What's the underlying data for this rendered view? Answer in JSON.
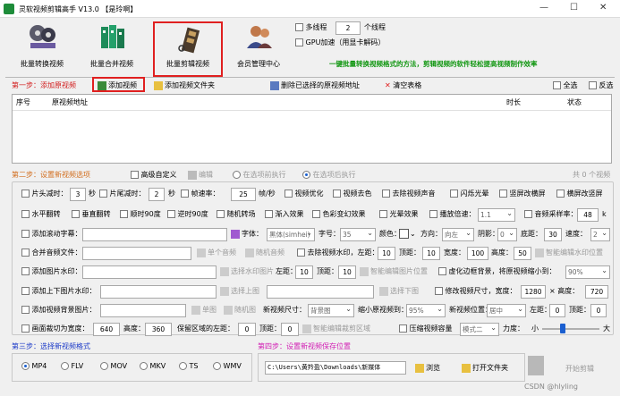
{
  "window": {
    "title": "灵软视频剪辑高手 V13.0   【是玲啊】",
    "min": "—",
    "max": "☐",
    "close": "✕"
  },
  "toolbar": {
    "items": [
      {
        "label": "批量转换视频"
      },
      {
        "label": "批量合并视频"
      },
      {
        "label": "批量剪辑视频"
      },
      {
        "label": "会员管理中心"
      }
    ],
    "multithread_label": "多线程",
    "thread_count": "2",
    "thread_unit": "个线程",
    "gpu_label": "GPU加速（用显卡解码）",
    "slogan": "一键批量转换视频格式的方法，剪辑视频的软件轻松提高视频制作效率"
  },
  "step1": {
    "title": "第一步：添加原视频",
    "add_video": "添加视频",
    "add_folder": "添加视频文件夹",
    "delete_selected": "删除已选择的原视频地址",
    "clear_table": "清空表格",
    "select_all": "全选",
    "invert": "反选"
  },
  "table": {
    "headers": [
      "序号",
      "原视频地址",
      "时长",
      "状态"
    ]
  },
  "step2": {
    "title": "第二步：设置新视频选项",
    "advanced": "高级自定义",
    "edit": "编辑",
    "exec_before": "在选项前执行",
    "exec_after": "在选项后执行",
    "count": "共 0 个视频",
    "r1": {
      "head_cut": "片头减时：",
      "head_val": "3",
      "sec1": "秒",
      "tail_cut": "片尾减时：",
      "tail_val": "2",
      "sec2": "秒",
      "framerate": "帧速率：",
      "fr_val": "25",
      "fr_unit": "帧/秒",
      "optimize": "视频优化",
      "decolor": "视频去色",
      "remove_audio": "去除视频声音",
      "flash": "闪烁光晕",
      "landscape": "竖屏改横屏",
      "portrait": "横屏改竖屏"
    },
    "r2": {
      "hflip": "水平翻转",
      "vflip": "垂直翻转",
      "cw90": "顺时90度",
      "ccw90": "逆时90度",
      "random": "随机转场",
      "fadein": "渐入效果",
      "color_change": "色彩变幻效果",
      "light": "光晕效果",
      "speed": "播放倍速：",
      "speed_val": "1.1",
      "samplerate": "音频采样率：",
      "sr_val": "48",
      "sr_unit": "k"
    },
    "r3": {
      "subtitle": "添加滚动字幕：",
      "font": "字体：",
      "font_val": "黑体(simhei)",
      "size": "字号：",
      "size_val": "35",
      "color": "颜色：",
      "dir": "方向：",
      "dir_val": "向左",
      "shadow": "阴影：",
      "shadow_val": "0",
      "bottom": "底距：",
      "bottom_val": "30",
      "speed": "速度：",
      "speed_val": "2"
    },
    "r4": {
      "merge_audio": "合并音频文件：",
      "single_audio": "单个音频",
      "random_audio": "随机音频",
      "remove_wm": "去除视频水印，左距：",
      "left_val": "10",
      "top": "顶距：",
      "top_val": "10",
      "width": "宽度：",
      "width_val": "100",
      "height": "高度：",
      "height_val": "50",
      "smart_remove": "智能编辑水印位置"
    },
    "r5": {
      "add_img_wm": "添加图片水印：",
      "select_wm": "选择水印图片",
      "left": "左距：",
      "left_val": "10",
      "top": "顶距：",
      "top_val": "10",
      "smart_img": "智能编辑图片位置",
      "blur_bg": "虚化边框背景，将原视频缩小到：",
      "scale_val": "90%"
    },
    "r6": {
      "add_tb_wm": "添加上下图片水印：",
      "select_top": "选择上图",
      "select_bottom": "选择下图",
      "resize": "修改视频尺寸，宽度：",
      "w_val": "1280",
      "x": "× 高度：",
      "h_val": "720"
    },
    "r7": {
      "add_bg": "添加视频背景图片：",
      "single": "单图",
      "random": "随机图",
      "new_size": "新视频尺寸：",
      "size_val": "背景图",
      "shrink": "缩小原视频到：",
      "shrink_val": "95%",
      "pos": "新视频位置：",
      "pos_val": "居中",
      "left": "左距：",
      "left_val": "0",
      "top": "顶距：",
      "top_val": "0"
    },
    "r8": {
      "crop": "画面裁切为宽度：",
      "w_val": "640",
      "height": "高度：",
      "h_val": "360",
      "keep_left": "保留区域的左距：",
      "left_val": "0",
      "top": "顶距：",
      "top_val": "0",
      "smart_crop": "智能编辑裁剪区域",
      "compress": "压缩视频容量",
      "mode_val": "模式二",
      "strength": "力度：",
      "small": "小",
      "big": "大"
    }
  },
  "step3": {
    "title": "第三步：选择新视频格式",
    "formats": [
      "MP4",
      "FLV",
      "MOV",
      "MKV",
      "TS",
      "WMV"
    ],
    "selected": 0
  },
  "step4": {
    "title": "第四步：设置新视频保存位置",
    "path": "C:\\Users\\黄羚盈\\Downloads\\新媒体",
    "browse": "浏览",
    "open_folder": "打开文件夹",
    "start": "开始剪辑"
  },
  "watermark": "CSDN @hlyling"
}
